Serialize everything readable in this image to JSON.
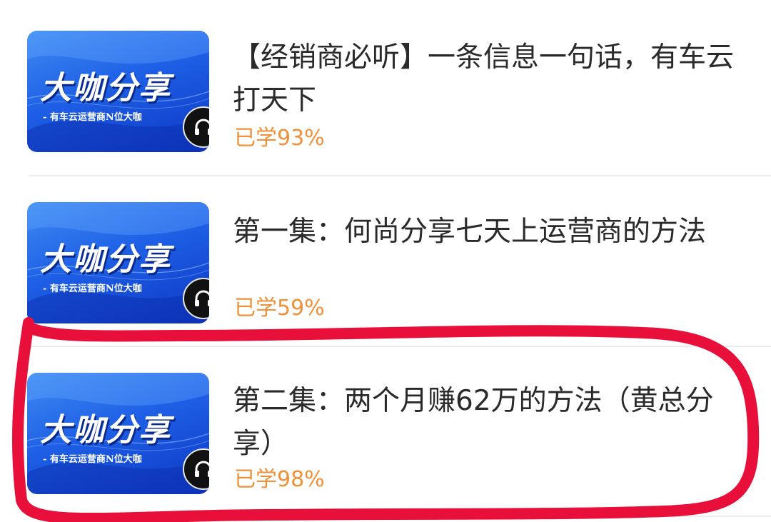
{
  "thumbnail": {
    "title": "大咖分享",
    "subtitle": "- 有车云运营商N位大咖",
    "badge_icon": "headphones-icon"
  },
  "courses": [
    {
      "title": "【经销商必听】一条信息一句话，有车云打天下",
      "progress": "已学93%",
      "progress_value": 93
    },
    {
      "title": "第一集：何尚分享七天上运营商的方法",
      "progress": "已学59%",
      "progress_value": 59
    },
    {
      "title": "第二集：两个月赚62万的方法（黄总分享）",
      "progress": "已学98%",
      "progress_value": 98
    }
  ],
  "colors": {
    "progress_text": "#f0913a",
    "title_text": "#2a2a2a",
    "thumbnail_blue": "#1e5fe6",
    "annotation_red": "#e8103a"
  }
}
